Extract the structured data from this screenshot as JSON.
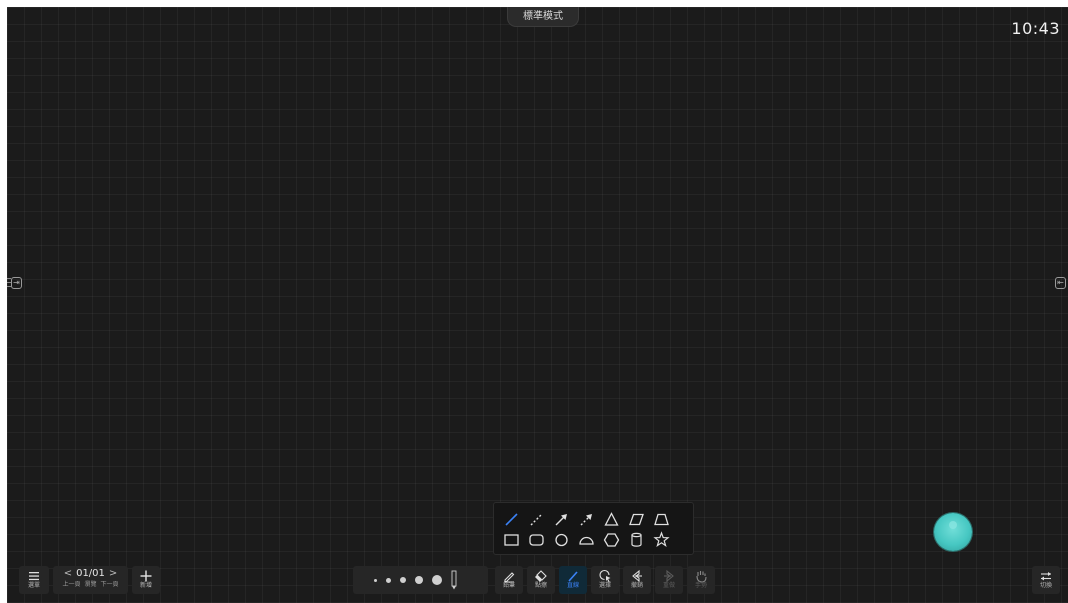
{
  "mode_tab": {
    "label": "標準模式"
  },
  "clock": {
    "time": "10:43"
  },
  "shapes": {
    "row1": [
      "line",
      "dashed-line",
      "arrow",
      "dashed-arrow",
      "triangle",
      "parallelogram",
      "trapezoid"
    ],
    "row2": [
      "rectangle",
      "rounded-rectangle",
      "circle",
      "semicircle",
      "hexagon",
      "cylinder",
      "star"
    ],
    "selected": "line"
  },
  "toolbar": {
    "menu_label": "選單",
    "page_current": "01/01",
    "prev_label": "上一頁",
    "browse_label": "瀏覽",
    "next_label": "下一頁",
    "add_label": "新增",
    "tools": [
      {
        "key": "pencil",
        "label": "鉛筆",
        "active": false,
        "dim": false
      },
      {
        "key": "eraser",
        "label": "點擦",
        "active": false,
        "dim": false
      },
      {
        "key": "line",
        "label": "直線",
        "active": true,
        "dim": false
      },
      {
        "key": "select",
        "label": "選擇",
        "active": false,
        "dim": false
      },
      {
        "key": "undo",
        "label": "撤銷",
        "active": false,
        "dim": false
      },
      {
        "key": "redo",
        "label": "重做",
        "active": false,
        "dim": true
      },
      {
        "key": "gesture",
        "label": "手勢",
        "active": false,
        "dim": true
      }
    ],
    "switch_label": "切換"
  },
  "colors": {
    "canvas": "#1b1b1b",
    "accent": "#3b82f6",
    "float_ball": "#46c7c2"
  }
}
